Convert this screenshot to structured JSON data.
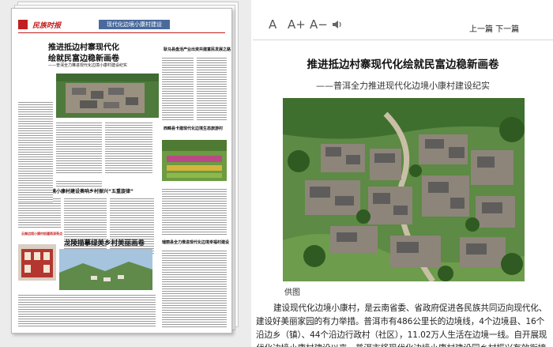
{
  "newspaper": {
    "masthead": "民族时报",
    "section": "现代化边境小康村建设",
    "headline_1": "推进抵边村寨现代化",
    "headline_2": "绘就民富边稳新画卷",
    "subheadline": "——普洱全力推进现代化边境小康村建设纪实",
    "side_heading_1": "耿马县盘活产业出资共建富民发展之路",
    "side_heading_2": "西畴县卡建现代化边境生态旅游村",
    "headline_3": "文山州边境小康村建设奏响乡村振兴“五重旋律”",
    "headline_4": "龙陵描摹绿美乡村美丽画卷",
    "side_heading_3": "瑞丽县全力推进现代化边境幸福村建设",
    "box_heading": "云南边境小康村创建再添亮点"
  },
  "toolbar": {
    "font_large": "A",
    "font_plus": "A+",
    "font_minus": "A−",
    "prev_next": "上一篇 下一篇"
  },
  "article": {
    "title": "推进抵边村寨现代化绘就民富边稳新画卷",
    "subtitle": "——普洱全力推进现代化边境小康村建设纪实",
    "caption": "供图",
    "body": "建设现代化边境小康村，是云南省委、省政府促进各民族共同迈向现代化、建设好美丽家园的有力举措。普洱市有486公里长的边境线，4个边境县、16个沿边乡（镇）、44个沿边行政村（社区），11.02万人生活在边境一线。自开展现代化边境小康村建设以来，普洱市将现代化边境小康村建设同乡村振兴有效衔接"
  },
  "colors": {
    "accent_red": "#c21f1f",
    "section_blue": "#4a6a9c"
  },
  "icons": [
    "speaker-icon"
  ]
}
